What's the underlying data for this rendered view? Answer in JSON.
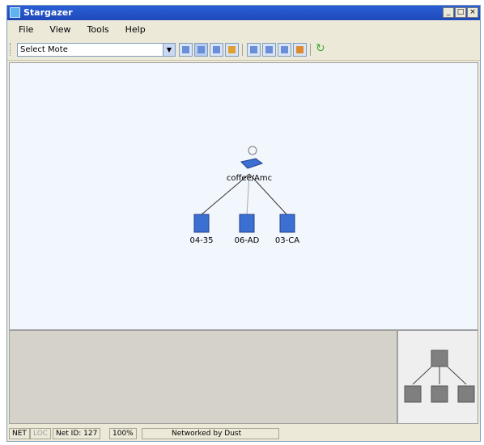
{
  "window": {
    "title": "Stargazer",
    "min_glyph": "_",
    "max_glyph": "□",
    "close_glyph": "×"
  },
  "menu": {
    "items": [
      "File",
      "View",
      "Tools",
      "Help"
    ]
  },
  "toolbar": {
    "select_value": "Select Mote",
    "dropdown_glyph": "▼",
    "refresh_glyph": "↻"
  },
  "graph": {
    "root": {
      "label": "coffee/Amc"
    },
    "children": [
      {
        "label": "04-35"
      },
      {
        "label": "06-AD"
      },
      {
        "label": "03-CA"
      }
    ]
  },
  "status": {
    "net": "NET",
    "loc": "LOC",
    "net_id": "Net ID: 127",
    "zoom": "100%",
    "networked_by": "Networked by Dust"
  },
  "colors": {
    "titlebar": "#1f48b8",
    "canvas_bg": "#f2f6fd",
    "node_blue": "#3b6fd1"
  }
}
